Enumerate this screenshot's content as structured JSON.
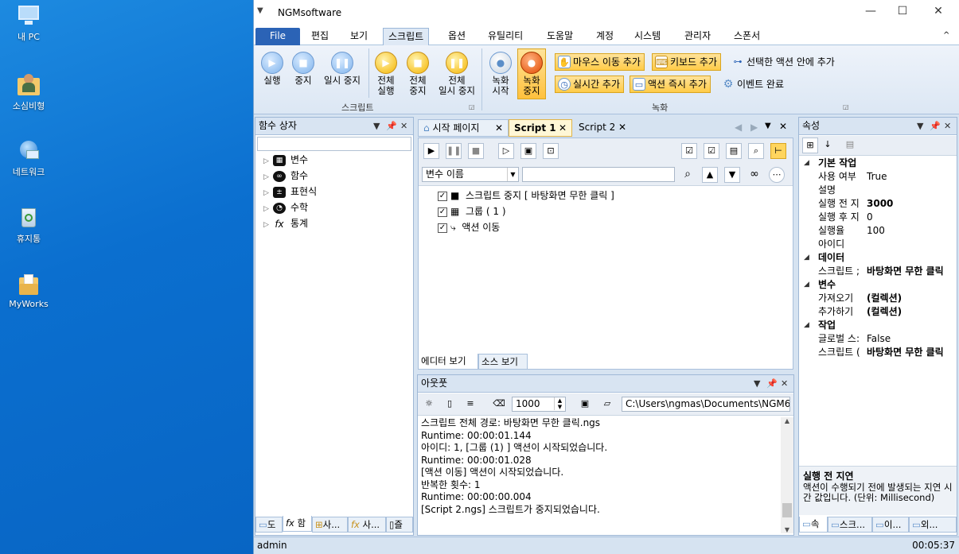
{
  "desktop": {
    "icons": [
      {
        "label": "내 PC",
        "icon": "computer-icon"
      },
      {
        "label": "소심비형",
        "icon": "user-folder-icon"
      },
      {
        "label": "네트워크",
        "icon": "network-icon"
      },
      {
        "label": "휴지통",
        "icon": "recycle-bin-icon"
      },
      {
        "label": "MyWorks",
        "icon": "folder-icon"
      }
    ]
  },
  "window": {
    "title": "NGMsoftware",
    "menu_glyph": "▼",
    "minimize": "—",
    "maximize": "☐",
    "close": "✕"
  },
  "ribbon_tabs": [
    "File",
    "편집",
    "보기",
    "스크립트",
    "옵션",
    "유틸리티",
    "도움말",
    "계정",
    "시스템",
    "관리자",
    "스폰서"
  ],
  "active_tab": "스크립트",
  "ribbon": {
    "collapse_glyph": "^",
    "group_script": "스크립트",
    "group_record": "녹화",
    "buttons": {
      "run": "실행",
      "stop": "중지",
      "pause": "일시 중지",
      "run_all_1": "전체",
      "run_all_2": "실행",
      "stop_all_1": "전체",
      "stop_all_2": "중지",
      "pause_all_1": "전체",
      "pause_all_2": "일시 중지",
      "rec_start_1": "녹화",
      "rec_start_2": "시작",
      "rec_stop_1": "녹화",
      "rec_stop_2": "중지"
    },
    "small": {
      "mouse_move": "마우스 이동 추가",
      "keyboard": "키보드 추가",
      "in_selected": "선택한 액션 안에 추가",
      "realtime": "실시간 추가",
      "immediate": "액션 즉시 추가",
      "event_done": "이벤트 완료"
    }
  },
  "func_box": {
    "title": "함수 상자",
    "items": [
      {
        "label": "변수",
        "icon": "variable-icon"
      },
      {
        "label": "함수",
        "icon": "function-icon"
      },
      {
        "label": "표현식",
        "icon": "expression-icon"
      },
      {
        "label": "수학",
        "icon": "math-icon"
      },
      {
        "label": "통계",
        "icon": "statistics-icon"
      }
    ],
    "bottom_tabs": [
      "도",
      "함",
      "사...",
      "사...",
      "즐"
    ]
  },
  "doc_tabs": [
    "시작 페이지",
    "Script 1",
    "Script 2"
  ],
  "active_doc": "Script 1",
  "editor": {
    "var_select": "변수 이름",
    "search_value": "",
    "rows": [
      {
        "label": "스크립트 중지 [ 바탕화면 무한 클릭 ]",
        "checked": true
      },
      {
        "label": "그룹 ( 1 )",
        "checked": true
      },
      {
        "label": "액션 이동",
        "checked": true
      }
    ],
    "view_tabs": [
      "에디터 보기",
      "소스 보기"
    ]
  },
  "output": {
    "title": "아웃풋",
    "count": "1000",
    "path": "C:\\Users\\ngmas\\Documents\\NGM6\\",
    "lines": [
      "스크립트 전체 경로: 바탕화면 무한 클릭.ngs",
      "Runtime: 00:00:01.144",
      "아이디: 1, [그룹 (1) ] 액션이 시작되었습니다.",
      "Runtime: 00:00:01.028",
      "[액션 이동] 액션이 시작되었습니다.",
      "반복한 횟수: 1",
      "Runtime: 00:00:00.004",
      "[Script 2.ngs] 스크립트가 중지되었습니다."
    ]
  },
  "props": {
    "title": "속성",
    "sections": [
      {
        "name": "기본 작업",
        "rows": [
          {
            "k": "사용 여부",
            "v": "True",
            "bold": false
          },
          {
            "k": "설명",
            "v": "",
            "bold": false
          },
          {
            "k": "실행 전 지",
            "v": "3000",
            "bold": true
          },
          {
            "k": "실행 후 지",
            "v": "0",
            "bold": false
          },
          {
            "k": "실행율",
            "v": "100",
            "bold": false
          },
          {
            "k": "아이디",
            "v": "",
            "bold": false
          }
        ]
      },
      {
        "name": "데이터",
        "rows": [
          {
            "k": "스크립트 ;",
            "v": "바탕화면 무한 클릭",
            "bold": true
          }
        ]
      },
      {
        "name": "변수",
        "rows": [
          {
            "k": "가져오기",
            "v": "(컬렉션)",
            "bold": true
          },
          {
            "k": "추가하기",
            "v": "(컬렉션)",
            "bold": true
          }
        ]
      },
      {
        "name": "작업",
        "rows": [
          {
            "k": "글로벌 스:",
            "v": "False",
            "bold": false
          },
          {
            "k": "스크립트 (",
            "v": "바탕화면 무한 클릭",
            "bold": true
          }
        ]
      }
    ],
    "desc_title": "실행 전 지연",
    "desc_text": "액션이 수행되기 전에 발생되는 지연 시간 값입니다. (단위: Millisecond)",
    "bottom_tabs": [
      "속",
      "스크...",
      "이...",
      "외..."
    ]
  },
  "status": {
    "user": "admin",
    "time": "00:05:37"
  }
}
